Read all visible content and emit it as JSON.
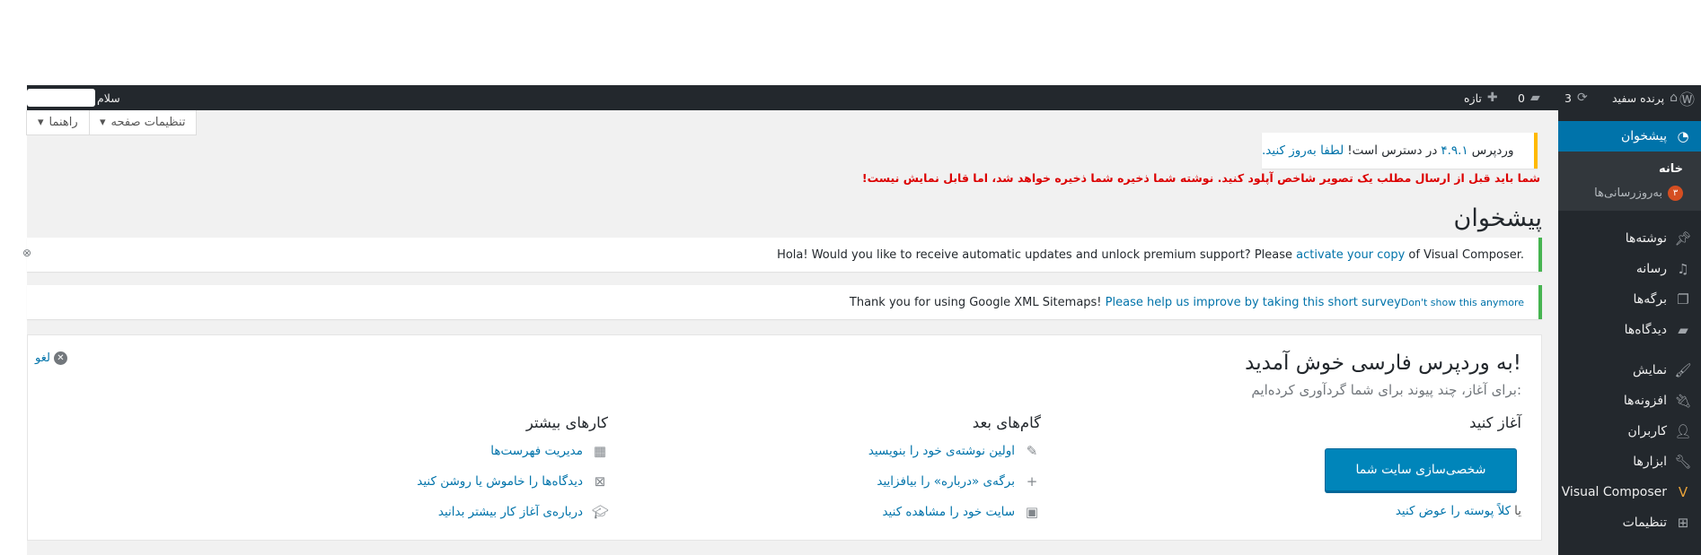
{
  "adminbar": {
    "site_name": "پرنده سفید",
    "updates_count": "3",
    "comments_count": "0",
    "new_label": "تازه",
    "greeting": "سلام"
  },
  "sidebar": {
    "dashboard": "پیشخوان",
    "sub_home": "خانه",
    "sub_updates": "به‌روزرسانی‌ها",
    "updates_badge": "۳",
    "posts": "نوشته‌ها",
    "media": "رسانه",
    "pages": "برگه‌ها",
    "comments": "دیدگاه‌ها",
    "appearance": "نمایش",
    "plugins": "افزونه‌ها",
    "users": "کاربران",
    "tools": "ابزارها",
    "visual_composer": "Visual Composer",
    "settings": "تنظیمات"
  },
  "screen_meta": {
    "screen_options": "تنظیمات صفحه",
    "help": "راهنما"
  },
  "update_notice": {
    "text_pre": "وردپرس",
    "version": "۴.۹.۱",
    "text_mid": "در دسترس است!",
    "link": "لطفا به‌روز کنید."
  },
  "red_warning": "شما باید قبل از ارسال مطلب یک تصویر شاخص آپلود کنید. نوشته شما ذخیره شما ذخیره خواهد شد، اما قابل نمایش نیست!",
  "page_title": "پیشخوان",
  "vc_notice": {
    "pre": "Hola! Would you like to receive automatic updates and unlock premium support? Please ",
    "link": "activate your copy",
    "post": " of Visual Composer."
  },
  "sitemap_notice": {
    "thanks": "Thank you for using Google XML Sitemaps!",
    "link": "Please help us improve by taking this short survey",
    "dont_show": "Don't show this anymore"
  },
  "welcome": {
    "title": "به وردپرس فارسی خوش آمدید!",
    "about": "برای آغاز، چند پیوند برای شما گردآوری کرده‌ایم:",
    "dismiss": "لغو",
    "get_started": "آغاز کنید",
    "customize_button": "شخصی‌سازی سایت شما",
    "or": "یا",
    "change_theme": "کلاً پوسته را عوض کنید",
    "next_steps": "گام‌های بعد",
    "next_items": [
      {
        "label": "اولین نوشته‌ی خود را بنویسید",
        "icon": "edit-icon"
      },
      {
        "label": "برگه‌ی «درباره» را بیافزایید",
        "icon": "plus-icon"
      },
      {
        "label": "سایت خود را مشاهده کنید",
        "icon": "view-site-icon"
      }
    ],
    "more_actions": "کارهای بیشتر",
    "more_items": [
      {
        "label": "مدیریت فهرست‌ها",
        "icon": "menus-icon"
      },
      {
        "label": "دیدگاه‌ها را خاموش یا روشن کنید",
        "icon": "comments-toggle-icon"
      },
      {
        "label": "درباره‌ی آغاز کار بیشتر بدانید",
        "icon": "learn-more-icon"
      }
    ]
  }
}
